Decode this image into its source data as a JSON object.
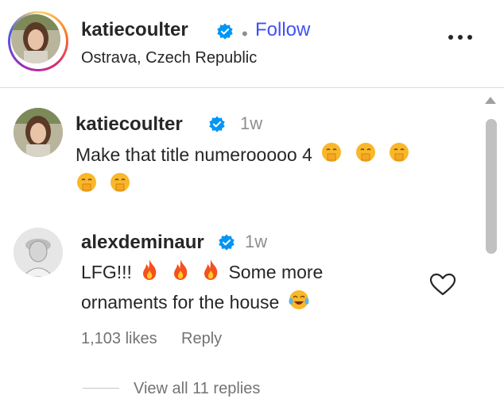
{
  "post_header": {
    "username": "katiecoulter",
    "dot": "•",
    "follow_label": "Follow",
    "location": "Ostrava, Czech Republic"
  },
  "comments": [
    {
      "username": "katiecoulter",
      "time": "1w",
      "text_line1": "Make that title numerooooo 4",
      "emoji_line1": [
        "hand-over-mouth-emoji",
        "hand-over-mouth-emoji",
        "hand-over-mouth-emoji"
      ],
      "emoji_line2": [
        "hand-over-mouth-emoji",
        "hand-over-mouth-emoji"
      ]
    },
    {
      "username": "alexdeminaur",
      "time": "1w",
      "text_start": "LFG!!!",
      "fire_emoji": [
        "fire-emoji",
        "fire-emoji",
        "fire-emoji"
      ],
      "text_after_fire": "Some more",
      "text_line2": "ornaments for the house",
      "line2_emoji": "tears-of-joy-emoji",
      "likes": "1,103 likes",
      "reply_label": "Reply",
      "view_replies": "View all 11 replies"
    }
  ],
  "colors": {
    "follow": "#4150f7",
    "verified": "#0095f6",
    "muted": "#737373"
  }
}
